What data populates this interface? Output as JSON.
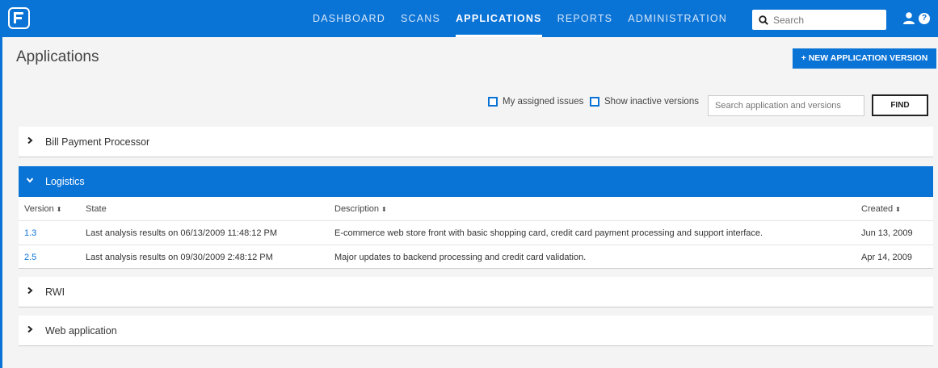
{
  "nav": {
    "items": [
      {
        "label": "DASHBOARD",
        "active": false
      },
      {
        "label": "SCANS",
        "active": false
      },
      {
        "label": "APPLICATIONS",
        "active": true
      },
      {
        "label": "REPORTS",
        "active": false
      },
      {
        "label": "ADMINISTRATION",
        "active": false
      }
    ],
    "search_placeholder": "Search"
  },
  "page": {
    "title": "Applications",
    "new_button_label": "+ NEW APPLICATION VERSION"
  },
  "filters": {
    "my_assigned_label": "My assigned issues",
    "show_inactive_label": "Show inactive versions",
    "search_placeholder": "Search application and versions",
    "find_label": "FIND"
  },
  "apps": [
    {
      "name": "Bill Payment Processor",
      "expanded": false
    },
    {
      "name": "Logistics",
      "expanded": true
    },
    {
      "name": "RWI",
      "expanded": false
    },
    {
      "name": "Web application",
      "expanded": false
    }
  ],
  "table": {
    "headers": [
      "Version",
      "State",
      "Description",
      "Created"
    ],
    "rows": [
      {
        "version": "1.3",
        "state": "Last analysis results on 06/13/2009 11:48:12 PM",
        "description": "E-commerce web store front with basic shopping card, credit card payment processing and support interface.",
        "created": "Jun 13, 2009"
      },
      {
        "version": "2.5",
        "state": "Last analysis results on 09/30/2009 2:48:12 PM",
        "description": "Major updates to backend processing and credit card validation.",
        "created": "Apr 14, 2009"
      }
    ]
  },
  "colors": {
    "accent": "#0a73d6"
  }
}
